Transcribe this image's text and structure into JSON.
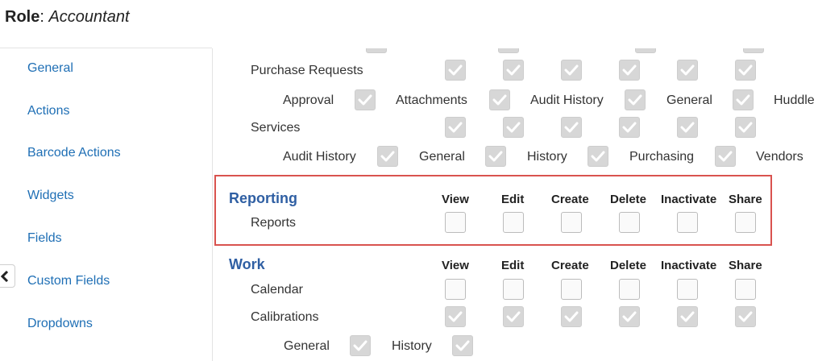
{
  "header": {
    "role_label": "Role",
    "role_sep": ": ",
    "role_name": "Accountant"
  },
  "sidebar": {
    "items": [
      {
        "label": "General"
      },
      {
        "label": "Actions"
      },
      {
        "label": "Barcode Actions"
      },
      {
        "label": "Widgets"
      },
      {
        "label": "Fields"
      },
      {
        "label": "Custom Fields"
      },
      {
        "label": "Dropdowns"
      }
    ]
  },
  "columns": [
    "View",
    "Edit",
    "Create",
    "Delete",
    "Inactivate",
    "Share"
  ],
  "permissions": {
    "purchase_requests": {
      "label": "Purchase Requests",
      "checked": [
        true,
        true,
        true,
        true,
        true,
        true
      ],
      "sub": [
        {
          "label": "Approval",
          "checked": true
        },
        {
          "label": "Attachments",
          "checked": true
        },
        {
          "label": "Audit History",
          "checked": true
        },
        {
          "label": "General",
          "checked": true
        },
        {
          "label": "Huddle",
          "checked": false
        }
      ]
    },
    "services": {
      "label": "Services",
      "checked": [
        true,
        true,
        true,
        true,
        true,
        true
      ],
      "sub": [
        {
          "label": "Audit History",
          "checked": true
        },
        {
          "label": "General",
          "checked": true
        },
        {
          "label": "History",
          "checked": true
        },
        {
          "label": "Purchasing",
          "checked": true
        },
        {
          "label": "Vendors",
          "checked": false
        }
      ]
    },
    "reporting": {
      "title": "Reporting",
      "rows": [
        {
          "label": "Reports",
          "checked": [
            false,
            false,
            false,
            false,
            false,
            false
          ]
        }
      ]
    },
    "work": {
      "title": "Work",
      "rows": [
        {
          "label": "Calendar",
          "checked": [
            false,
            false,
            false,
            false,
            false,
            false
          ]
        },
        {
          "label": "Calibrations",
          "checked": [
            true,
            true,
            true,
            true,
            true,
            true
          ]
        }
      ],
      "sub": [
        {
          "label": "General",
          "checked": true
        },
        {
          "label": "History",
          "checked": true
        }
      ]
    }
  },
  "colors": {
    "link": "#1f6fb5",
    "section": "#2f5fa3",
    "highlight": "#d9534f"
  }
}
